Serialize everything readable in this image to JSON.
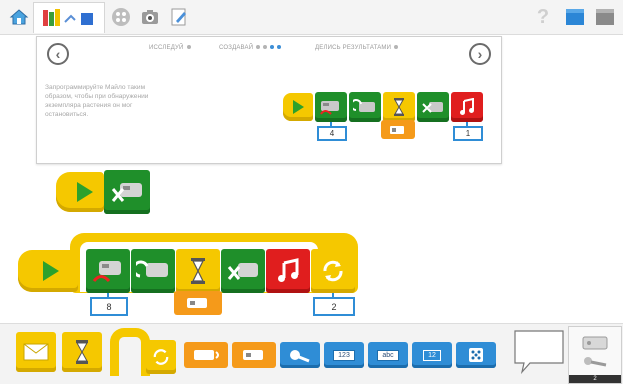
{
  "nav_steps": {
    "investigate": "ИССЛЕДУЙ",
    "create": "СОЗДАВАЙ",
    "share": "ДЕЛИСЬ РЕЗУЛЬТАТАМИ"
  },
  "instruction": "Запрограммируйте Майло таким образом, чтобы при обнаружении экземпляра растения он мог остановиться.",
  "example_program": {
    "motor_power_value": "4",
    "sound_value": "1"
  },
  "loop_program": {
    "motor_power_value": "8",
    "repeat_value": "2"
  },
  "palette": {
    "number_label": "123",
    "text_label": "abc",
    "display_label": "12"
  },
  "corner_panel": {
    "count": "2"
  },
  "icons": {
    "home": "home-icon",
    "help": "help-icon"
  },
  "colors": {
    "motor_green": "#1f8f2a",
    "wait_yellow": "#f5c800",
    "sound_red": "#e01e1e",
    "input_orange": "#f59a1a",
    "label_blue": "#2f8dd6"
  }
}
